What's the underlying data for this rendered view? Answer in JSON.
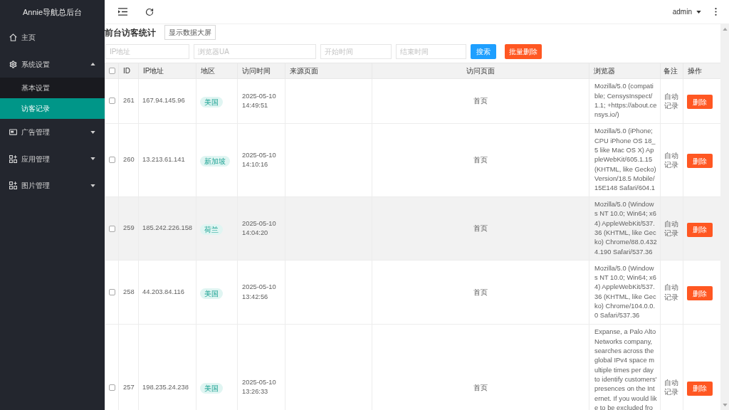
{
  "sidebar": {
    "logo": "Annie导航总后台",
    "items": [
      {
        "kind": "link",
        "label": "主页"
      },
      {
        "kind": "group",
        "label": "系统设置",
        "expanded": true,
        "children": [
          {
            "label": "基本设置",
            "selected": false
          },
          {
            "label": "访客记录",
            "selected": true
          }
        ]
      },
      {
        "kind": "group",
        "label": "广告管理",
        "expanded": false
      },
      {
        "kind": "group",
        "label": "应用管理",
        "expanded": false
      },
      {
        "kind": "group",
        "label": "图片管理",
        "expanded": false
      }
    ]
  },
  "header": {
    "user": "admin"
  },
  "page": {
    "title": "前台访客统计",
    "screen_button": "显示数据大屏"
  },
  "filters": {
    "fields": [
      {
        "placeholder": "IP地址"
      },
      {
        "placeholder": "浏览器UA"
      },
      {
        "placeholder": "开始时间"
      },
      {
        "placeholder": "结束时间"
      }
    ],
    "search_button": "搜索",
    "batch_delete_button": "批量删除"
  },
  "table": {
    "select_all": {
      "checked": false
    },
    "columns": [
      "ID",
      "IP地址",
      "地区",
      "访问时间",
      "来源页面",
      "访问页面",
      "浏览器",
      "备注",
      "操作"
    ],
    "rows": [
      {
        "checked": false,
        "highlighted": false,
        "id": "261",
        "ip": "167.94.145.96",
        "region": "美国",
        "time": "2025-05-10 14:49:51",
        "page": "首页",
        "browser": "Mozilla/5.0 (compatible; CensysInspect/1.1; +https://about.censys.io/)",
        "note": "自动记录",
        "action": "删除"
      },
      {
        "checked": false,
        "highlighted": false,
        "id": "260",
        "ip": "13.213.61.141",
        "region": "新加坡",
        "time": "2025-05-10 14:10:16",
        "page": "首页",
        "browser": "Mozilla/5.0 (iPhone; CPU iPhone OS 18_5 like Mac OS X) AppleWebKit/605.1.15 (KHTML, like Gecko) Version/18.5 Mobile/15E148 Safari/604.1",
        "note": "自动记录",
        "action": "删除"
      },
      {
        "checked": false,
        "highlighted": true,
        "id": "259",
        "ip": "185.242.226.158",
        "region": "荷兰",
        "time": "2025-05-10 14:04:20",
        "page": "首页",
        "browser": "Mozilla/5.0 (Windows NT 10.0; Win64; x64) AppleWebKit/537.36 (KHTML, like Gecko) Chrome/88.0.4324.190 Safari/537.36",
        "note": "自动记录",
        "action": "删除"
      },
      {
        "checked": false,
        "highlighted": false,
        "id": "258",
        "ip": "44.203.84.116",
        "region": "美国",
        "time": "2025-05-10 13:42:56",
        "page": "首页",
        "browser": "Mozilla/5.0 (Windows NT 10.0; Win64; x64) AppleWebKit/537.36 (KHTML, like Gecko) Chrome/104.0.0.0 Safari/537.36",
        "note": "自动记录",
        "action": "删除"
      },
      {
        "checked": false,
        "highlighted": false,
        "id": "257",
        "ip": "198.235.24.238",
        "region": "美国",
        "time": "2025-05-10 13:26:33",
        "page": "首页",
        "browser": "Expanse, a Palo Alto Networks company, searches across the global IPv4 space multiple times per day to identify customers' presences on the Internet. If you would like to be excluded fro",
        "note": "自动记录",
        "action": "删除"
      }
    ]
  }
}
